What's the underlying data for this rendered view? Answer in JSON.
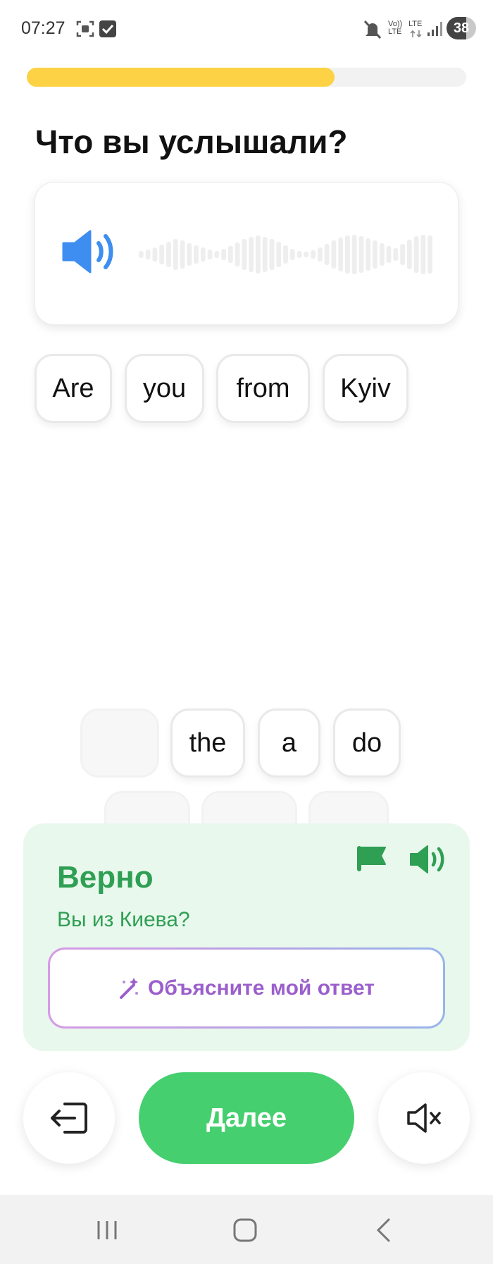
{
  "status_bar": {
    "time": "07:27",
    "battery": "38",
    "net_volte": "Vo)) LTE",
    "net_lte": "LTE"
  },
  "progress": {
    "value": 0.7
  },
  "question": "Что вы услышали?",
  "selected_words": [
    "Are",
    "you",
    "from",
    "Kyiv"
  ],
  "word_bank": [
    "the",
    "a",
    "do"
  ],
  "result": {
    "title": "Верно",
    "translation": "Вы из Киева?",
    "explain_label": "Объясните мой ответ"
  },
  "actions": {
    "next_label": "Далее"
  },
  "icons": {
    "speaker": "speaker-icon",
    "flag": "flag-icon",
    "exit": "exit-icon",
    "mute": "mute-icon",
    "magic": "magic-wand-icon"
  },
  "colors": {
    "progress": "#fdd244",
    "success": "#2e9f53",
    "success_bg": "#e9f8ed",
    "next_button": "#45cf6e",
    "speaker": "#3d8ef0",
    "explain": "#9b5fcc"
  }
}
